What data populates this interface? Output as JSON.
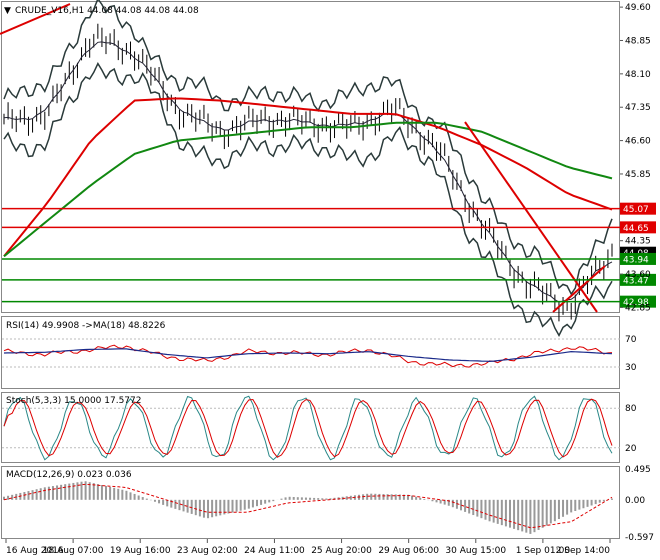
{
  "symbol_title": "CRUDE_V16,H1  44.08 44.08 44.08 44.08",
  "price_axis": [
    "49.60",
    "48.85",
    "48.10",
    "47.35",
    "46.60",
    "45.85",
    "44.35",
    "43.60",
    "42.85"
  ],
  "price_ylim": [
    42.77,
    49.67
  ],
  "horizontal_levels": [
    {
      "price": 45.07,
      "label": "45.07",
      "color": "#e00000"
    },
    {
      "price": 44.65,
      "label": "44.65",
      "color": "#e00000"
    },
    {
      "price": 44.08,
      "label": "44.08",
      "color": "#000000"
    },
    {
      "price": 43.94,
      "label": "43.94",
      "color": "#008800"
    },
    {
      "price": 43.47,
      "label": "43.47",
      "color": "#008800"
    },
    {
      "price": 42.98,
      "label": "42.98",
      "color": "#008800"
    }
  ],
  "time_axis": [
    "16 Aug 2016",
    "18 Aug 07:00",
    "19 Aug 16:00",
    "23 Aug 02:00",
    "24 Aug 11:00",
    "25 Aug 20:00",
    "29 Aug 06:00",
    "30 Aug 15:00",
    "1 Sep 01:00",
    "2 Sep 14:00"
  ],
  "rsi_label": "RSI(14) 49.9908  ->MA(18) 48.8226",
  "rsi_axis": [
    "70",
    "30"
  ],
  "stoch_label": "Stoch(5,3,3) 15.0000 17.5772",
  "stoch_axis": [
    "80",
    "20"
  ],
  "macd_label": "MACD(12,26,9) 0.023 0.036",
  "macd_axis": [
    "0.495",
    "0.00",
    "-0.597"
  ],
  "colors": {
    "ma_red": "#dd0000",
    "ma_green": "#118811",
    "bands": "#2a3a3a",
    "rsi_main": "#1a2a8a",
    "signal": "#dd0000",
    "stoch_main": "#2a8888",
    "grid": "#bbbbbb",
    "border": "#888888"
  },
  "chart_data": [
    {
      "type": "line",
      "title": "CRUDE_V16,H1",
      "x": [
        "16 Aug 2016",
        "18 Aug 07:00",
        "19 Aug 16:00",
        "23 Aug 02:00",
        "24 Aug 11:00",
        "25 Aug 20:00",
        "29 Aug 06:00",
        "30 Aug 15:00",
        "1 Sep 01:00",
        "2 Sep 14:00"
      ],
      "ylim": [
        42.77,
        49.67
      ],
      "series": [
        {
          "values": [
            47.0,
            47.2,
            48.9,
            48.6,
            47.3,
            46.8,
            47.1,
            47.0,
            46.9,
            47.3,
            46.4,
            44.7,
            43.4,
            42.85,
            44.1
          ]
        },
        {
          "values": [
            44.0,
            45.2,
            46.6,
            47.5,
            47.55,
            47.5,
            47.4,
            47.3,
            47.2,
            47.2,
            46.9,
            46.5,
            46.0,
            45.4,
            45.05
          ]
        },
        {
          "values": [
            44.0,
            44.8,
            45.6,
            46.3,
            46.6,
            46.7,
            46.8,
            46.9,
            46.9,
            47.0,
            47.0,
            46.8,
            46.4,
            46.0,
            45.75
          ]
        }
      ]
    },
    {
      "type": "line",
      "title": "RSI(14) 49.9908  ->MA(18) 48.8226",
      "ylim": [
        0,
        100
      ],
      "series": [
        {
          "values": [
            52,
            48,
            54,
            60,
            45,
            38,
            52,
            50,
            48,
            55,
            38,
            32,
            35,
            48,
            58,
            50
          ]
        },
        {
          "values": [
            50,
            51,
            55,
            56,
            48,
            43,
            49,
            50,
            49,
            52,
            45,
            40,
            38,
            44,
            52,
            49
          ]
        }
      ]
    },
    {
      "type": "line",
      "title": "Stoch(5,3,3) 15.0000 17.5772",
      "ylim": [
        0,
        100
      ],
      "series": [
        {
          "values": [
            70,
            20,
            85,
            15,
            80,
            10,
            65,
            25,
            90,
            15,
            55,
            30,
            85,
            10,
            80,
            15
          ]
        },
        {
          "values": [
            60,
            30,
            75,
            25,
            70,
            20,
            55,
            35,
            80,
            25,
            50,
            35,
            75,
            20,
            70,
            18
          ]
        }
      ]
    },
    {
      "type": "bar",
      "title": "MACD(12,26,9) 0.023 0.036",
      "ylim": [
        -0.597,
        0.495
      ],
      "series": [
        {
          "values": [
            0.05,
            0.2,
            0.3,
            0.15,
            -0.1,
            -0.3,
            -0.15,
            0.05,
            0.02,
            0.1,
            0.08,
            -0.1,
            -0.35,
            -0.55,
            -0.2,
            0.02
          ]
        },
        {
          "values": [
            0.0,
            0.15,
            0.25,
            0.2,
            0.0,
            -0.2,
            -0.2,
            -0.05,
            0.0,
            0.06,
            0.07,
            -0.02,
            -0.25,
            -0.45,
            -0.35,
            0.04
          ]
        }
      ]
    }
  ]
}
